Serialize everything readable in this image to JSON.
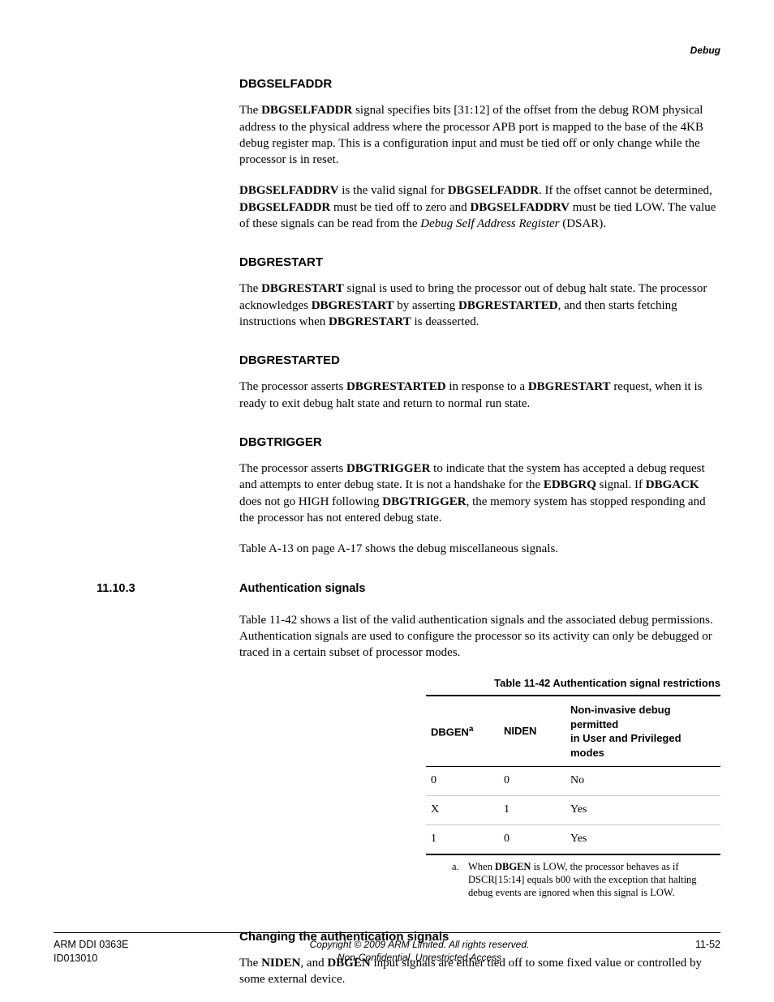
{
  "header": {
    "section_label": "Debug"
  },
  "sections": {
    "dbgselfaddr": {
      "title": "DBGSELFADDR",
      "p1_a": "The ",
      "p1_b": "DBGSELFADDR",
      "p1_c": " signal specifies bits [31:12] of the offset from the debug ROM physical address to the physical address where the processor APB port is mapped to the base of the 4KB debug register map. This is a configuration input and must be tied off or only change while the processor is in reset.",
      "p2_a": "DBGSELFADDRV",
      "p2_b": " is the valid signal for ",
      "p2_c": "DBGSELFADDR",
      "p2_d": ". If the offset cannot be determined, ",
      "p2_e": "DBGSELFADDR",
      "p2_f": " must be tied off to zero and ",
      "p2_g": "DBGSELFADDRV",
      "p2_h": " must be tied LOW. The value of these signals can be read from the ",
      "p2_i": "Debug Self Address Register",
      "p2_j": " (DSAR)."
    },
    "dbgrestart": {
      "title": "DBGRESTART",
      "p1_a": "The ",
      "p1_b": "DBGRESTART",
      "p1_c": " signal is used to bring the processor out of debug halt state. The processor acknowledges ",
      "p1_d": "DBGRESTART",
      "p1_e": " by asserting ",
      "p1_f": "DBGRESTARTED",
      "p1_g": ", and then starts fetching instructions when ",
      "p1_h": "DBGRESTART",
      "p1_i": " is deasserted."
    },
    "dbgrestarted": {
      "title": "DBGRESTARTED",
      "p1_a": "The processor asserts ",
      "p1_b": "DBGRESTARTED",
      "p1_c": " in response to a ",
      "p1_d": "DBGRESTART",
      "p1_e": " request, when it is ready to exit debug halt state and return to normal run state."
    },
    "dbgtrigger": {
      "title": "DBGTRIGGER",
      "p1_a": "The processor asserts ",
      "p1_b": "DBGTRIGGER",
      "p1_c": " to indicate that the system has accepted a debug request and attempts to enter debug state. It is not a handshake for the ",
      "p1_d": "EDBGRQ",
      "p1_e": " signal. If ",
      "p1_f": "DBGACK",
      "p1_g": " does not go HIGH following ",
      "p1_h": "DBGTRIGGER",
      "p1_i": ", the memory system has stopped responding and the processor has not entered debug state.",
      "p2": "Table A-13 on page A-17 shows the debug miscellaneous signals."
    },
    "auth": {
      "number": "11.10.3",
      "title": "Authentication signals",
      "p1": "Table 11-42 shows a list of the valid authentication signals and the associated debug permissions. Authentication signals are used to configure the processor so its activity can only be debugged or traced in a certain subset of processor modes.",
      "table_caption": "Table 11-42 Authentication signal restrictions",
      "col1_pre": "DBGEN",
      "col1_sup": "a",
      "col2": "NIDEN",
      "col3_l1": "Non-invasive debug permitted",
      "col3_l2": "in User and Privileged modes",
      "rows": [
        {
          "c1": "0",
          "c2": "0",
          "c3": "No"
        },
        {
          "c1": "X",
          "c2": "1",
          "c3": "Yes"
        },
        {
          "c1": "1",
          "c2": "0",
          "c3": "Yes"
        }
      ],
      "note_marker": "a.",
      "note_a": "When ",
      "note_b": "DBGEN",
      "note_c": " is LOW, the processor behaves as if DSCR[15:14] equals b00 with the exception that halting debug events are ignored when this signal is LOW.",
      "changing_title": "Changing the authentication signals",
      "changing_p_a": "The ",
      "changing_p_b": "NIDEN",
      "changing_p_c": ", and ",
      "changing_p_d": "DBGEN",
      "changing_p_e": " input signals are either tied off to some fixed value or controlled by some external device."
    }
  },
  "footer": {
    "left_l1": "ARM DDI 0363E",
    "left_l2": "ID013010",
    "center_l1": "Copyright © 2009 ARM Limited. All rights reserved.",
    "center_l2": "Non-Confidential, Unrestricted Access",
    "right": "11-52"
  }
}
